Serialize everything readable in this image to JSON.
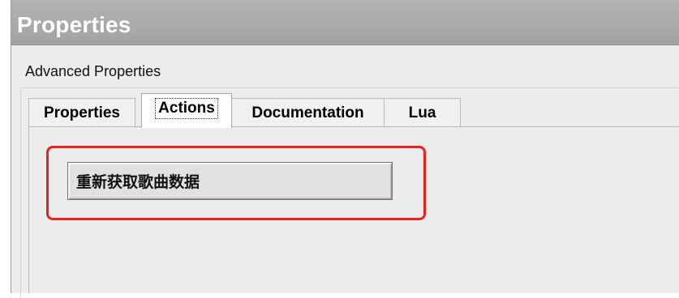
{
  "window": {
    "title": "Properties"
  },
  "section": {
    "label": "Advanced Properties"
  },
  "tabs": [
    {
      "label": "Properties",
      "active": false
    },
    {
      "label": "Actions",
      "active": true
    },
    {
      "label": "Documentation",
      "active": false
    },
    {
      "label": "Lua",
      "active": false
    }
  ],
  "actions_panel": {
    "button_label": "重新获取歌曲数据"
  },
  "colors": {
    "title_bar": "#a8a8a8",
    "highlight": "#e8231f",
    "panel_bg": "#ececec"
  }
}
